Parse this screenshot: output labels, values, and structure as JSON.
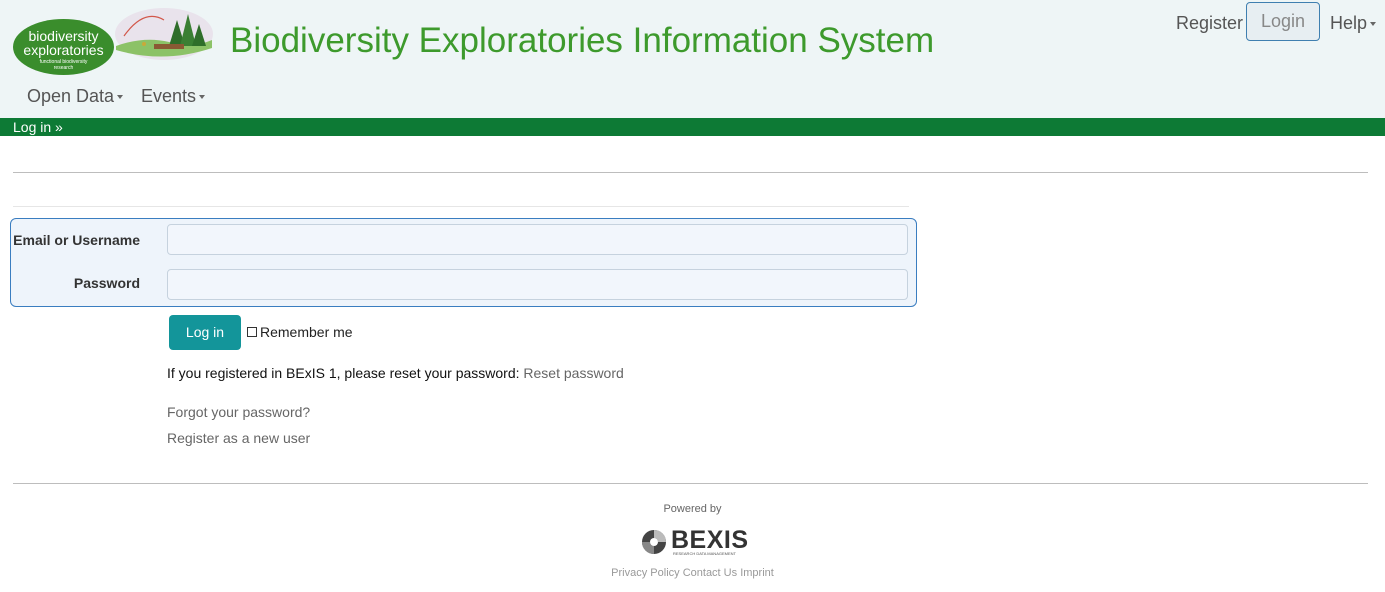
{
  "header": {
    "logo_text_line1": "biodiversity",
    "logo_text_line2": "exploratories",
    "logo_text_line3": "functional biodiversity",
    "logo_text_line4": "research",
    "title": "Biodiversity Exploratories Information System",
    "register": "Register",
    "login": "Login",
    "help": "Help"
  },
  "nav": {
    "open_data": "Open Data",
    "events": "Events"
  },
  "greenbar": {
    "toggle": "Log in »"
  },
  "form": {
    "username_label": "Email or Username",
    "password_label": "Password",
    "submit": "Log in",
    "remember": "Remember me",
    "bexis1_text": "If you registered in BExIS 1, please reset your password:",
    "reset_link": "Reset password",
    "forgot": "Forgot your password?",
    "register_new": "Register as a new user"
  },
  "footer": {
    "powered_by": "Powered by",
    "bexis_name": "BEXIS",
    "bexis_tagline": "RESEARCH DATA MANAGEMENT",
    "privacy": "Privacy Policy",
    "contact": "Contact Us",
    "imprint": "Imprint"
  },
  "colors": {
    "title_green": "#3d9a2c",
    "greenbar": "#0d7a35",
    "button_teal": "#13959a",
    "form_border": "#3a7dc0",
    "header_bg": "#eef5f6"
  }
}
